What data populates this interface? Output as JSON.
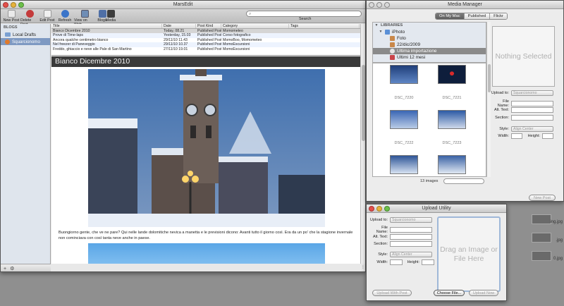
{
  "desktop": {
    "files": [
      {
        "label": "ing.jpg"
      },
      {
        "label": ".jpg"
      },
      {
        "label": "0.jpg"
      }
    ]
  },
  "marsedit": {
    "title": "MarsEdit",
    "toolbar": {
      "new_post": "New Post",
      "delete_post": "Delete Post",
      "edit_post": "Edit Post",
      "refresh": "Refresh",
      "view_on_web": "View on Web",
      "blogs": "Blogs",
      "media": "Media",
      "search_label": "Search",
      "search_placeholder": ""
    },
    "sidebar": {
      "heading": "BLOGS",
      "items": [
        {
          "label": "Local Drafts"
        },
        {
          "label": "Squarcionomo"
        }
      ]
    },
    "post_list": {
      "columns": [
        "Title",
        "Date",
        "Post Kind",
        "Category",
        "Tags"
      ],
      "rows": [
        [
          "Bianco Dicembre 2010",
          "Today, 08.21",
          "Published Post",
          "Momometeo",
          ""
        ],
        [
          "Prove di Time-laps",
          "Yesterday, 15.03",
          "Published Post",
          "Corso fotografico",
          ""
        ],
        [
          "Ancora qualche centimetro bianco",
          "29/11/10 11.43",
          "Published Post",
          "MomoBoo, Momometeo",
          ""
        ],
        [
          "Nel freezer di Paneveggio",
          "29/11/10 10.37",
          "Published Post",
          "MomoEscursioni",
          ""
        ],
        [
          "Freddo, ghiaccio e neve alle Pale di San Martino",
          "27/11/10 19.01",
          "Published Post",
          "MomoEscursioni",
          ""
        ]
      ]
    },
    "preview": {
      "title": "Bianco Dicembre 2010",
      "body": "Buongiorno gente, che ve ne pare? Qui nelle lande dolomitiche nevica a manetta e le previsioni dicono: Avanti tutto il giorno così. Era da un po' che la stagione invernale non cominciava con così tanta neve anche in paese."
    },
    "footer": {
      "add": "+",
      "gear": "⚙"
    }
  },
  "media_manager": {
    "title": "Media Manager",
    "tabs": [
      "On My Mac",
      "Published",
      "Flickr"
    ],
    "active_tab": "On My Mac",
    "library_heading": "LIBRARIES",
    "library": [
      {
        "label": "iPhoto",
        "indent": 1,
        "color": "#5a8fd6"
      },
      {
        "label": "Foto",
        "indent": 2,
        "color": "#c9884a"
      },
      {
        "label": "22/dic/2009",
        "indent": 2,
        "color": "#c9884a"
      },
      {
        "label": "Ultima importazione",
        "indent": 2,
        "color": "#777",
        "selected": true
      },
      {
        "label": "Ultimi 12 mesi",
        "indent": 2,
        "color": "#c9444a"
      }
    ],
    "thumbnails": [
      {
        "label": ""
      },
      {
        "label": ""
      },
      {
        "label": "DSC_7220"
      },
      {
        "label": "DSC_7221"
      },
      {
        "label": ""
      },
      {
        "label": ""
      },
      {
        "label": "DSC_7222"
      },
      {
        "label": "DSC_7223"
      },
      {
        "label": ""
      },
      {
        "label": ""
      }
    ],
    "image_count": "13 images",
    "nothing_selected": "Nothing Selected",
    "fields": {
      "upload_to_label": "Upload to:",
      "upload_to_value": "Squarcionomo",
      "file_name_label": "File Name:",
      "alt_text_label": "Alt. Text:",
      "section_label": "Section:",
      "style_label": "Style:",
      "style_value": "Align Center",
      "width_label": "Width:",
      "height_label": "Height:"
    },
    "new_post_button": "New Post"
  },
  "upload_utility": {
    "title": "Upload Utility",
    "fields": {
      "upload_to_label": "Upload to:",
      "upload_to_value": "Squarcionomo",
      "file_name_label": "File Name:",
      "alt_text_label": "Alt. Text:",
      "section_label": "Section:",
      "style_label": "Style:",
      "style_value": "Align Center",
      "width_label": "Width:",
      "height_label": "Height:"
    },
    "drop_zone": "Drag an Image or File Here",
    "buttons": {
      "upload_with_post": "Upload With Post",
      "choose_file": "Choose File...",
      "upload_now": "Upload Now"
    }
  }
}
